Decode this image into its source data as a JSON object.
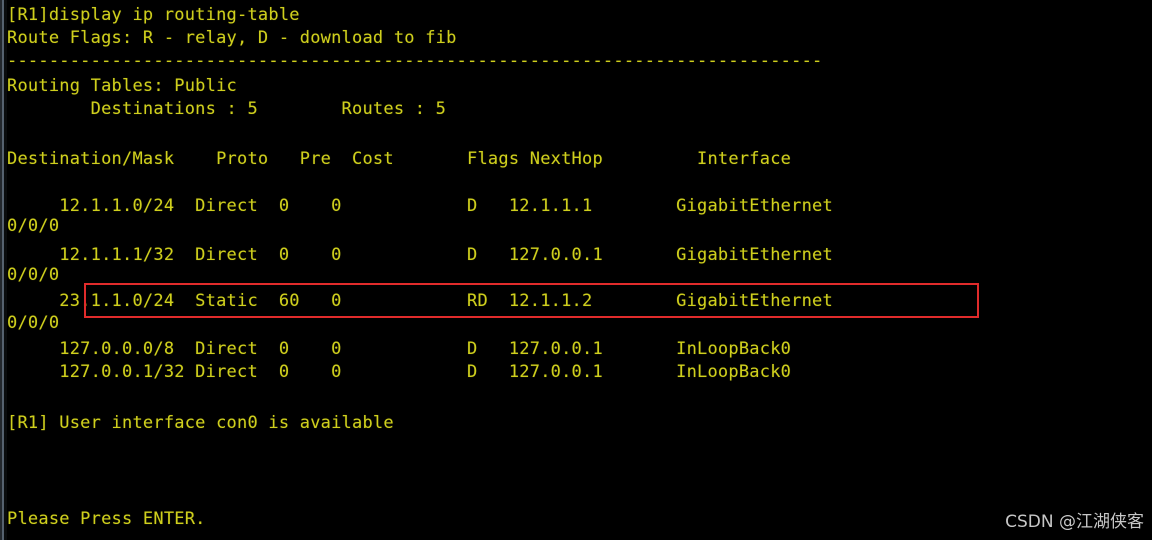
{
  "terminal": {
    "title": "display ip routing-table",
    "background_color": "#000000",
    "text_color": "#cfcf1d",
    "highlight_color": "#e02b2b",
    "watermark_color": "#d8d8d8"
  },
  "lines": {
    "command": "[R1]display ip routing-table",
    "route_flags": "Route Flags: R - relay, D - download to fib",
    "separator": "------------------------------------------------------------------------------",
    "routing_tables": "Routing Tables: Public",
    "counts": "        Destinations : 5        Routes : 5",
    "table_header": "Destination/Mask    Proto   Pre  Cost       Flags NextHop         Interface",
    "row1": "     12.1.1.0/24  Direct  0    0            D   12.1.1.1        GigabitEthernet",
    "row1_cont": "0/0/0",
    "row2": "     12.1.1.1/32  Direct  0    0            D   127.0.0.1       GigabitEthernet",
    "row2_cont": "0/0/0",
    "row3": "     23.1.1.0/24  Static  60   0            RD  12.1.1.2        GigabitEthernet",
    "row3_cont": "0/0/0",
    "row4": "     127.0.0.0/8  Direct  0    0            D   127.0.0.1       InLoopBack0",
    "row5": "     127.0.0.1/32 Direct  0    0            D   127.0.0.1       InLoopBack0",
    "user_interface": "[R1] User interface con0 is available",
    "press_enter": "Please Press ENTER."
  },
  "table_data": {
    "columns": [
      "Destination/Mask",
      "Proto",
      "Pre",
      "Cost",
      "Flags",
      "NextHop",
      "Interface"
    ],
    "rows": [
      {
        "destination_mask": "12.1.1.0/24",
        "proto": "Direct",
        "pre": "0",
        "cost": "0",
        "flags": "D",
        "nexthop": "12.1.1.1",
        "interface": "GigabitEthernet0/0/0",
        "highlighted": false
      },
      {
        "destination_mask": "12.1.1.1/32",
        "proto": "Direct",
        "pre": "0",
        "cost": "0",
        "flags": "D",
        "nexthop": "127.0.0.1",
        "interface": "GigabitEthernet0/0/0",
        "highlighted": false
      },
      {
        "destination_mask": "23.1.1.0/24",
        "proto": "Static",
        "pre": "60",
        "cost": "0",
        "flags": "RD",
        "nexthop": "12.1.1.2",
        "interface": "GigabitEthernet0/0/0",
        "highlighted": true
      },
      {
        "destination_mask": "127.0.0.0/8",
        "proto": "Direct",
        "pre": "0",
        "cost": "0",
        "flags": "D",
        "nexthop": "127.0.0.1",
        "interface": "InLoopBack0",
        "highlighted": false
      },
      {
        "destination_mask": "127.0.0.1/32",
        "proto": "Direct",
        "pre": "0",
        "cost": "0",
        "flags": "D",
        "nexthop": "127.0.0.1",
        "interface": "InLoopBack0",
        "highlighted": false
      }
    ],
    "destinations": "5",
    "routes": "5",
    "table_scope": "Public"
  },
  "watermark": {
    "text": "CSDN @江湖侠客"
  }
}
